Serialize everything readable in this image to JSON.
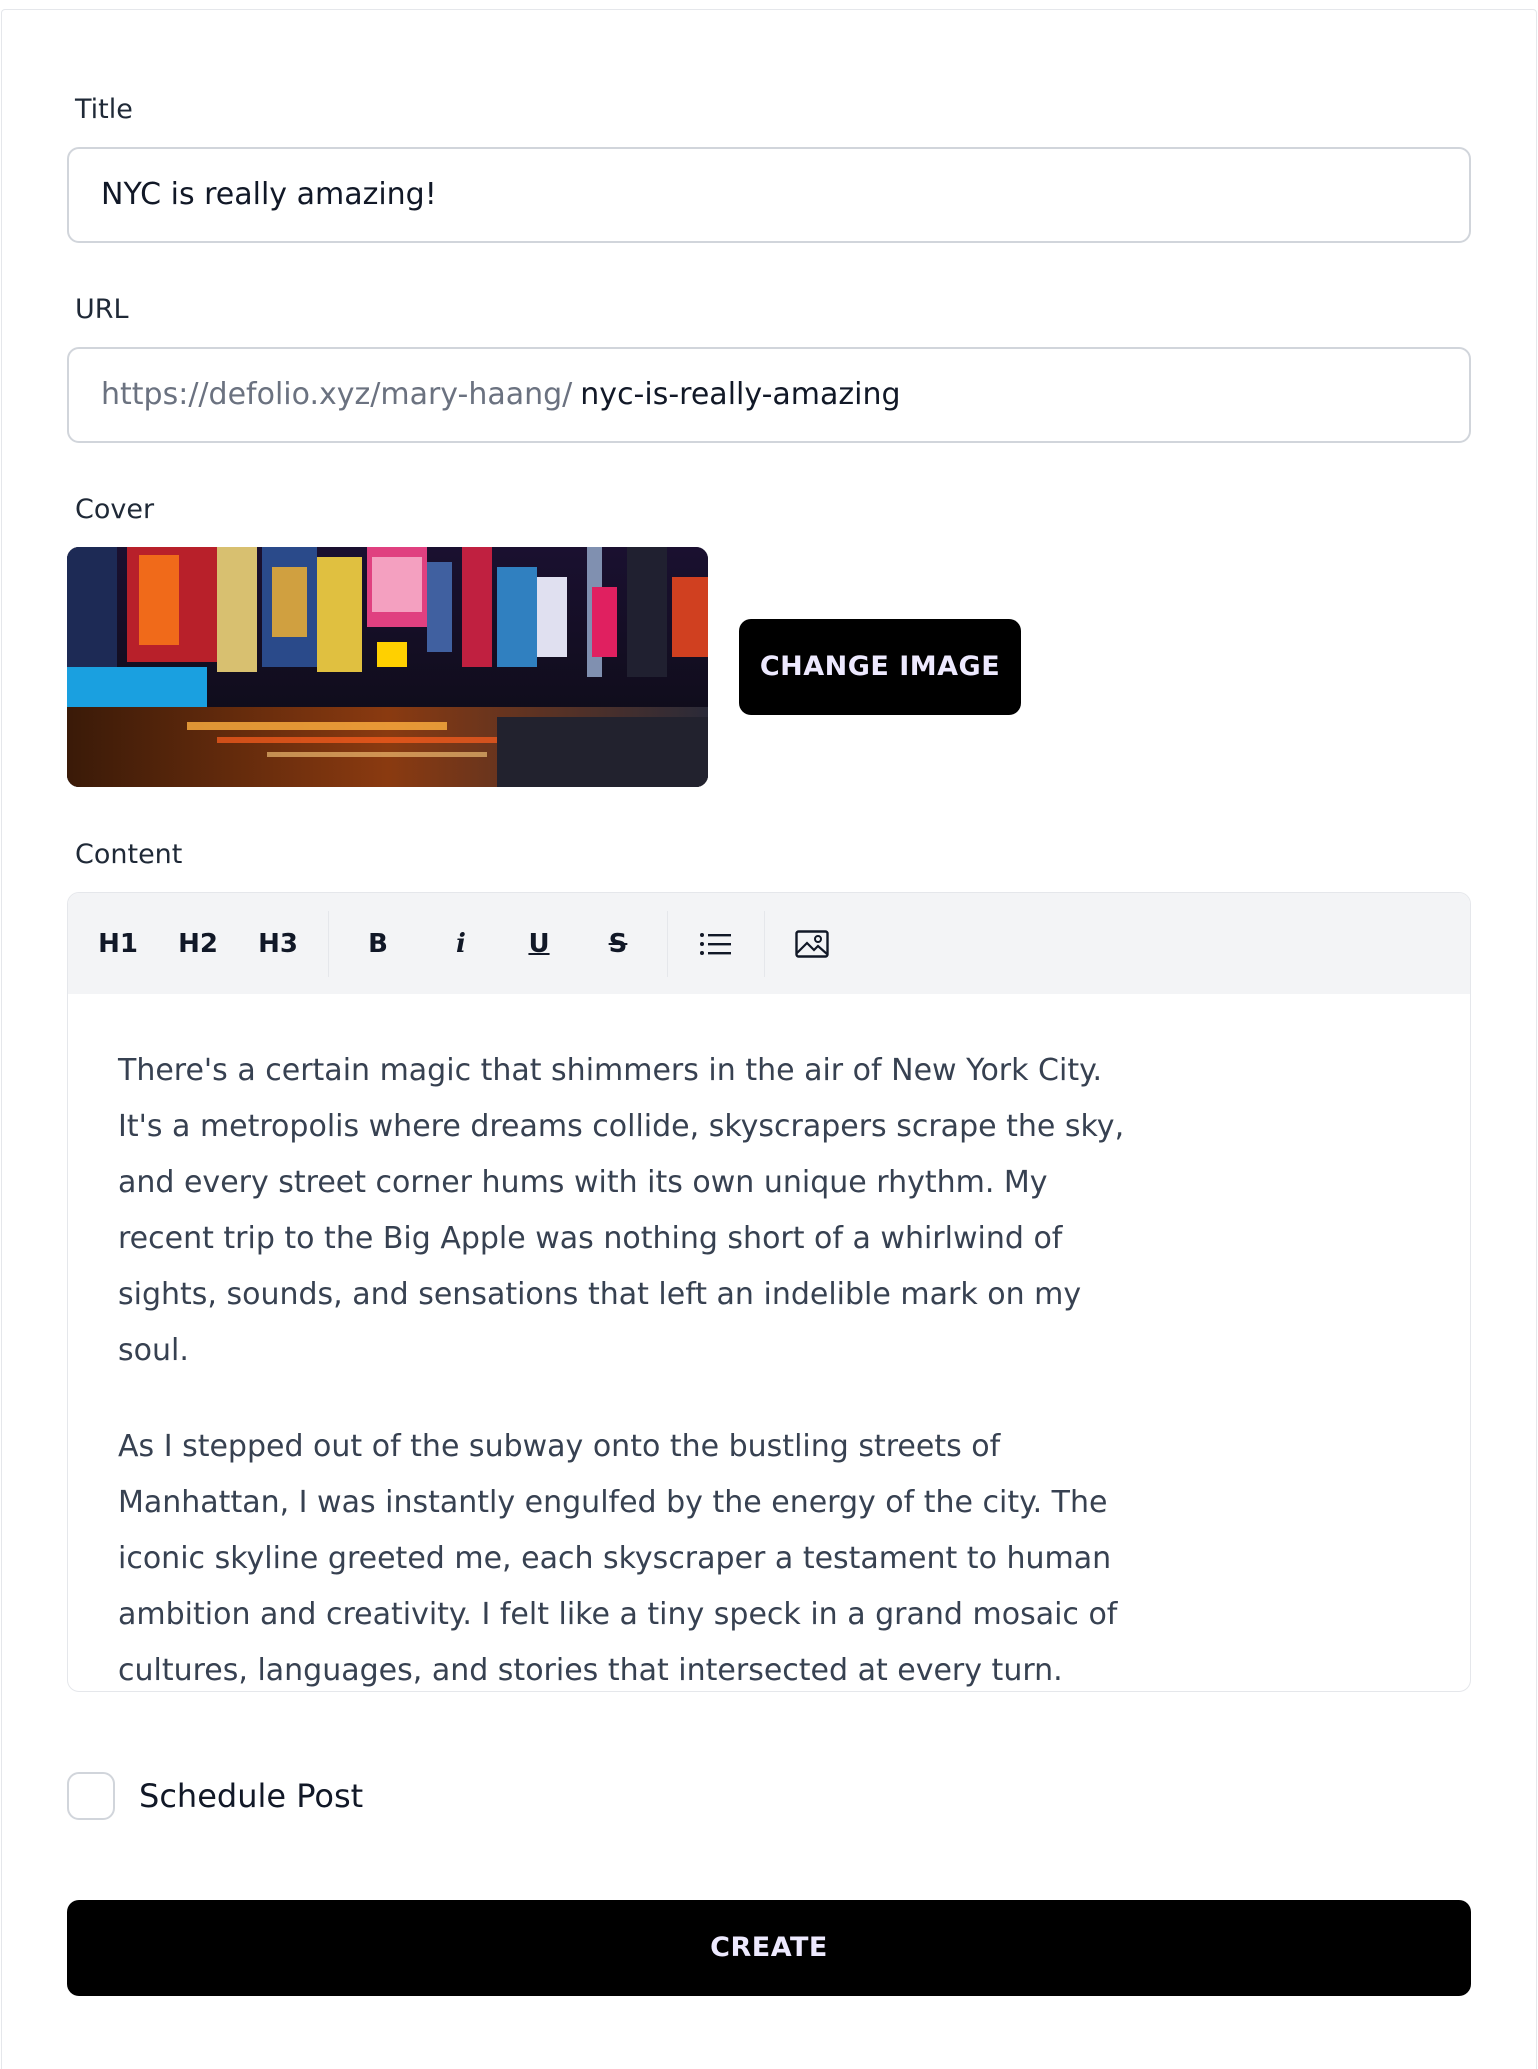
{
  "form": {
    "title_label": "Title",
    "title_value": "NYC is really amazing!",
    "url_label": "URL",
    "url_prefix": "https://defolio.xyz/mary-haang/",
    "url_slug": "nyc-is-really-amazing",
    "cover_label": "Cover",
    "change_image_label": "CHANGE IMAGE",
    "content_label": "Content"
  },
  "toolbar": {
    "h1": "H1",
    "h2": "H2",
    "h3": "H3",
    "bold": "B",
    "italic": "i",
    "underline": "U",
    "strike": "S",
    "icons": [
      "bullet-list-icon",
      "image-icon"
    ]
  },
  "content": {
    "paragraphs": [
      "There's a certain magic that shimmers in the air of New York City. It's a metropolis where dreams collide, skyscrapers scrape the sky, and every street corner hums with its own unique rhythm. My recent trip to the Big Apple was nothing short of a whirlwind of sights, sounds, and sensations that left an indelible mark on my soul.",
      "As I stepped out of the subway onto the bustling streets of Manhattan, I was instantly engulfed by the energy of the city. The iconic skyline greeted me, each skyscraper a testament to human ambition and creativity. I felt like a tiny speck in a grand mosaic of cultures, languages, and stories that intersected at every turn."
    ]
  },
  "schedule": {
    "label": "Schedule Post",
    "checked": false
  },
  "actions": {
    "create_label": "CREATE"
  },
  "colors": {
    "button_bg": "#000000",
    "button_text": "#ede9fe",
    "toolbar_bg": "#f3f4f6",
    "border": "#d1d5db"
  }
}
